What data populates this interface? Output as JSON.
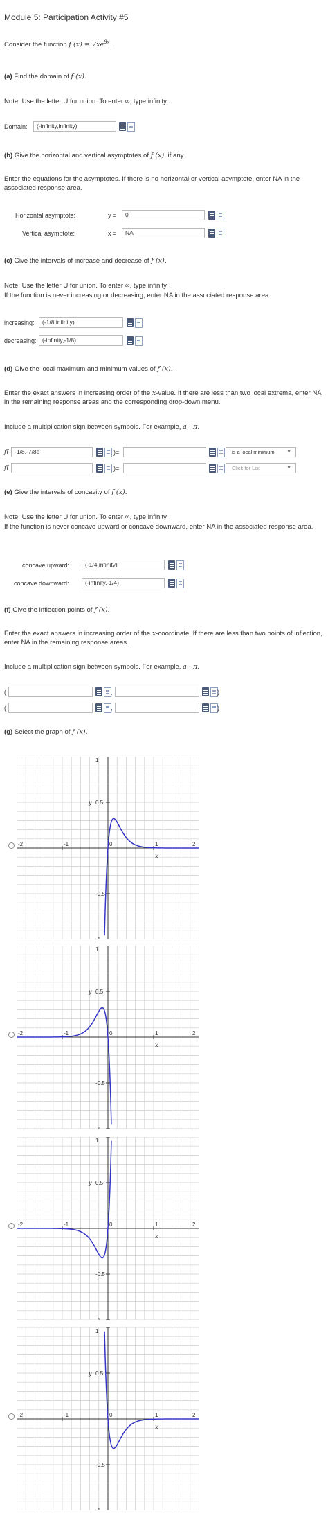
{
  "title": "Module 5: Participation Activity #5",
  "intro": {
    "text": "Consider the function",
    "func": "f (x) = 7xe",
    "exp": "8x"
  },
  "partA": {
    "label": "(a)",
    "question": "Find the domain of",
    "fx": "f (x).",
    "note_a": "Note: Use the letter U for union. To enter",
    "inf": "∞",
    "note_b": ", type infinity.",
    "field_label": "Domain:",
    "value": "(-infinity,infinity)"
  },
  "partB": {
    "label": "(b)",
    "question": "Give the horizontal and vertical asymptotes of",
    "fx": "f (x)",
    "question_end": ", if any.",
    "instructions": "Enter the equations for the asymptotes. If there is no horizontal or vertical asymptote, enter NA in the associated response area.",
    "h_label": "Horizontal asymptote:",
    "h_var": "y =",
    "h_value": "0",
    "v_label": "Vertical asymptote:",
    "v_var": "x =",
    "v_value": "NA"
  },
  "partC": {
    "label": "(c)",
    "question": "Give the intervals of increase and decrease of",
    "fx": "f (x).",
    "note_a": "Note: Use the letter U for union. To enter",
    "inf": "∞",
    "note_b": ", type infinity.",
    "note2": "If the function is never increasing or decreasing, enter NA in the associated response area.",
    "inc_label": "increasing:",
    "inc_value": "(-1/8,infinity)",
    "dec_label": "decreasing:",
    "dec_value": "(-infinity,-1/8)"
  },
  "partD": {
    "label": "(d)",
    "question": "Give the local maximum and minimum values of",
    "fx": "f (x).",
    "instructions_a": "Enter the exact answers in increasing order of the",
    "xvar": "x",
    "instructions_b": "-value. If there are less than two local extrema, enter NA in the remaining response areas and the corresponding drop-down menu.",
    "mult_note": "Include a multiplication sign between symbols. For example,",
    "mult_example": "a · π.",
    "row1": {
      "f": "f(",
      "x_value": "-1/8,-7/8e",
      "close": ")=",
      "y_value": "",
      "select": "is a local minimum"
    },
    "row2": {
      "f": "f(",
      "x_value": "",
      "close": ")=",
      "y_value": "",
      "select": "Click for List"
    }
  },
  "partE": {
    "label": "(e)",
    "question": "Give the intervals of concavity of",
    "fx": "f (x).",
    "note_a": "Note: Use the letter U for union. To enter",
    "inf": "∞",
    "note_b": ", type infinity.",
    "note2": "If the function is never concave upward or concave downward, enter NA in the associated response area.",
    "up_label": "concave upward:",
    "up_value": "(-1/4,infinity)",
    "down_label": "concave downward:",
    "down_value": "(-infinity,-1/4)"
  },
  "partF": {
    "label": "(f)",
    "question": "Give the inflection points of",
    "fx": "f (x).",
    "instructions_a": "Enter the exact answers in increasing order of the",
    "xvar": "x",
    "instructions_b": "-coordinate. If there are less than two points of inflection, enter NA in the remaining response areas.",
    "mult_note": "Include a multiplication sign between symbols. For example,",
    "mult_example": "a · π.",
    "open": "(",
    "comma": ",",
    "close": ")"
  },
  "partG": {
    "label": "(g)",
    "question": "Select the graph of",
    "fx": "f (x).",
    "axis": {
      "x_label": "x",
      "y_label": "y",
      "x_ticks": [
        "-2",
        "-1",
        "0",
        "1",
        "2"
      ],
      "y_ticks": [
        "1",
        "0.5",
        "-0.5",
        "-1"
      ]
    },
    "colors": {
      "curve": "#3535c8",
      "grid": "#cccccc",
      "axis": "#333333"
    }
  }
}
